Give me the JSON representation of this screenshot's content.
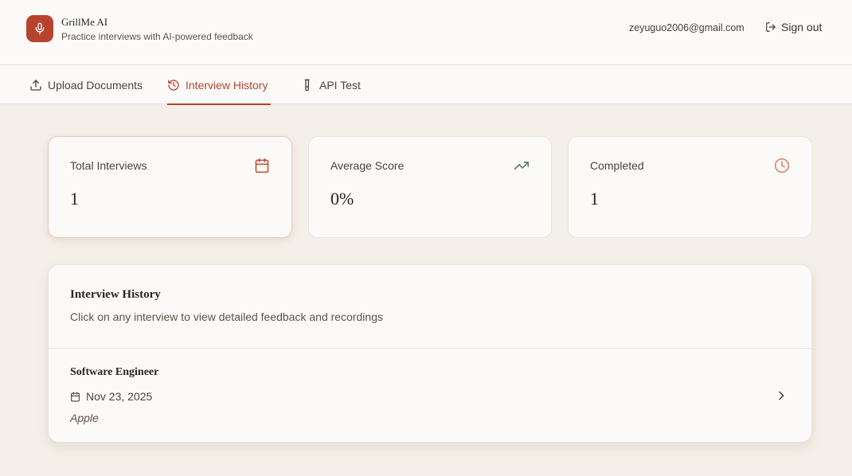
{
  "app": {
    "name": "GrillMe AI",
    "tagline": "Practice interviews with AI-powered feedback",
    "logo_icon": "microphone-icon",
    "accent_color": "#b6442c"
  },
  "header": {
    "user_email": "zeyuguo2006@gmail.com",
    "sign_out_label": "Sign out"
  },
  "tabs": [
    {
      "label": "Upload Documents",
      "icon": "upload-icon",
      "active": false
    },
    {
      "label": "Interview History",
      "icon": "history-icon",
      "active": true
    },
    {
      "label": "API Test",
      "icon": "test-tube-icon",
      "active": false
    }
  ],
  "stats": [
    {
      "label": "Total Interviews",
      "value": "1",
      "icon": "calendar-icon",
      "icon_color": "#c0553b"
    },
    {
      "label": "Average Score",
      "value": "0%",
      "icon": "trending-up-icon",
      "icon_color": "#5e7d6a"
    },
    {
      "label": "Completed",
      "value": "1",
      "icon": "clock-icon",
      "icon_color": "#d98b6a"
    }
  ],
  "history": {
    "title": "Interview History",
    "subtitle": "Click on any interview to view detailed feedback and recordings",
    "items": [
      {
        "title": "Software Engineer",
        "date": "Nov 23, 2025",
        "company": "Apple"
      }
    ]
  }
}
